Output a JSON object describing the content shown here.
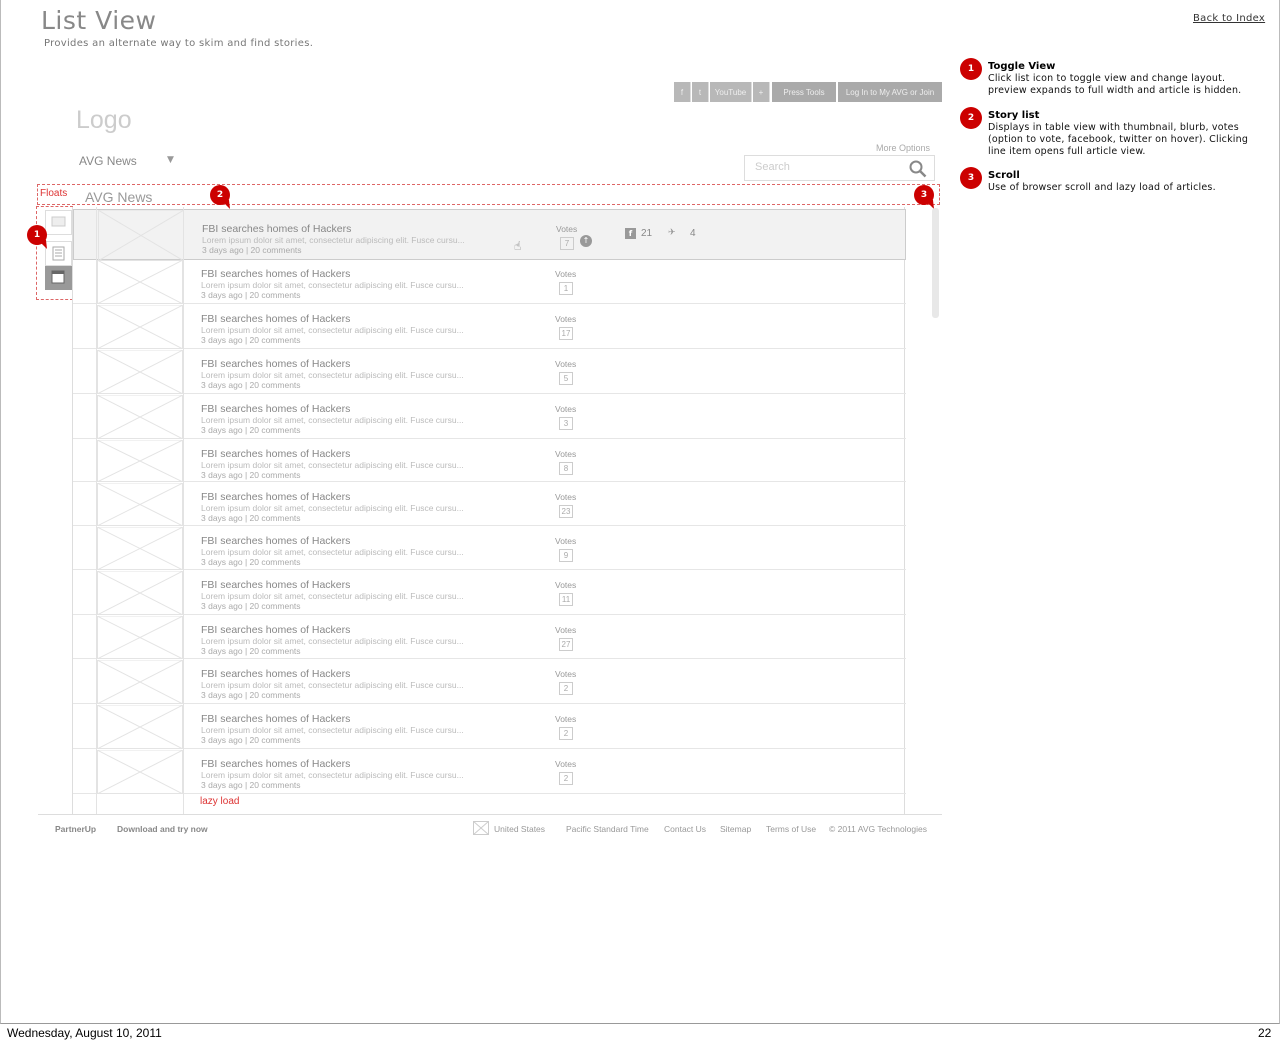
{
  "header": {
    "title": "List View",
    "subtitle": "Provides an alternate way to skim and find stories.",
    "back_link": "Back to Index"
  },
  "notes": [
    {
      "num": "1",
      "title": "Toggle View",
      "text": "Click list icon to toggle view and change layout. preview expands to full width and article is hidden."
    },
    {
      "num": "2",
      "title": "Story list",
      "text": "Displays in table view with thumbnail, blurb, votes (option to vote, facebook, twitter on hover). Clicking line item opens full article view."
    },
    {
      "num": "3",
      "title": "Scroll",
      "text": "Use of browser scroll and lazy load of articles."
    }
  ],
  "topbar": {
    "f": "f",
    "t": "t",
    "youtube": "YouTube",
    "plus": "+",
    "press": "Press Tools",
    "login": "Log In to My AVG or Join"
  },
  "logo": "Logo",
  "site_select": "AVG News",
  "more_options": "More Options",
  "search": {
    "placeholder": "Search"
  },
  "floats_label": "Floats",
  "section_title": "AVG News",
  "pins": {
    "p1": "1",
    "p2": "2",
    "p3": "3"
  },
  "stories": [
    {
      "title": "FBI searches homes of Hackers",
      "blurb": "Lorem ipsum dolor sit amet, consectetur adipiscing elit. Fusce cursu...",
      "meta": "3 days ago | 20 comments",
      "votes_label": "Votes",
      "votes": "7",
      "fb_count": "21",
      "tw_count": "4"
    },
    {
      "title": "FBI searches homes of Hackers",
      "blurb": "Lorem ipsum dolor sit amet, consectetur adipiscing elit. Fusce cursu...",
      "meta": "3 days ago | 20 comments",
      "votes_label": "Votes",
      "votes": "1"
    },
    {
      "title": "FBI searches homes of Hackers",
      "blurb": "Lorem ipsum dolor sit amet, consectetur adipiscing elit. Fusce cursu...",
      "meta": "3 days ago | 20 comments",
      "votes_label": "Votes",
      "votes": "17"
    },
    {
      "title": "FBI searches homes of Hackers",
      "blurb": "Lorem ipsum dolor sit amet, consectetur adipiscing elit. Fusce cursu...",
      "meta": "3 days ago | 20 comments",
      "votes_label": "Votes",
      "votes": "5"
    },
    {
      "title": "FBI searches homes of Hackers",
      "blurb": "Lorem ipsum dolor sit amet, consectetur adipiscing elit. Fusce cursu...",
      "meta": "3 days ago | 20 comments",
      "votes_label": "Votes",
      "votes": "3"
    },
    {
      "title": "FBI searches homes of Hackers",
      "blurb": "Lorem ipsum dolor sit amet, consectetur adipiscing elit. Fusce cursu...",
      "meta": "3 days ago | 20 comments",
      "votes_label": "Votes",
      "votes": "8"
    },
    {
      "title": "FBI searches homes of Hackers",
      "blurb": "Lorem ipsum dolor sit amet, consectetur adipiscing elit. Fusce cursu...",
      "meta": "3 days ago | 20 comments",
      "votes_label": "Votes",
      "votes": "23"
    },
    {
      "title": "FBI searches homes of Hackers",
      "blurb": "Lorem ipsum dolor sit amet, consectetur adipiscing elit. Fusce cursu...",
      "meta": "3 days ago | 20 comments",
      "votes_label": "Votes",
      "votes": "9"
    },
    {
      "title": "FBI searches homes of Hackers",
      "blurb": "Lorem ipsum dolor sit amet, consectetur adipiscing elit. Fusce cursu...",
      "meta": "3 days ago | 20 comments",
      "votes_label": "Votes",
      "votes": "11"
    },
    {
      "title": "FBI searches homes of Hackers",
      "blurb": "Lorem ipsum dolor sit amet, consectetur adipiscing elit. Fusce cursu...",
      "meta": "3 days ago | 20 comments",
      "votes_label": "Votes",
      "votes": "27"
    },
    {
      "title": "FBI searches homes of Hackers",
      "blurb": "Lorem ipsum dolor sit amet, consectetur adipiscing elit. Fusce cursu...",
      "meta": "3 days ago | 20 comments",
      "votes_label": "Votes",
      "votes": "2"
    },
    {
      "title": "FBI searches homes of Hackers",
      "blurb": "Lorem ipsum dolor sit amet, consectetur adipiscing elit. Fusce cursu...",
      "meta": "3 days ago | 20 comments",
      "votes_label": "Votes",
      "votes": "2"
    },
    {
      "title": "FBI searches homes of Hackers",
      "blurb": "Lorem ipsum dolor sit amet, consectetur adipiscing elit. Fusce cursu...",
      "meta": "3 days ago | 20 comments",
      "votes_label": "Votes",
      "votes": "2"
    }
  ],
  "lazy_load": "lazy load",
  "footer": {
    "partnerup": "PartnerUp",
    "download": "Download and try now",
    "country": "United States",
    "timezone": "Pacific Standard Time",
    "contact": "Contact Us",
    "sitemap": "Sitemap",
    "terms": "Terms of Use",
    "copyright": "© 2011 AVG Technologies"
  },
  "bottom": {
    "date": "Wednesday, August 10, 2011",
    "page": "22"
  },
  "colors": {
    "annotation": "#cc0000",
    "wire_gray": "#aaaaaa"
  }
}
